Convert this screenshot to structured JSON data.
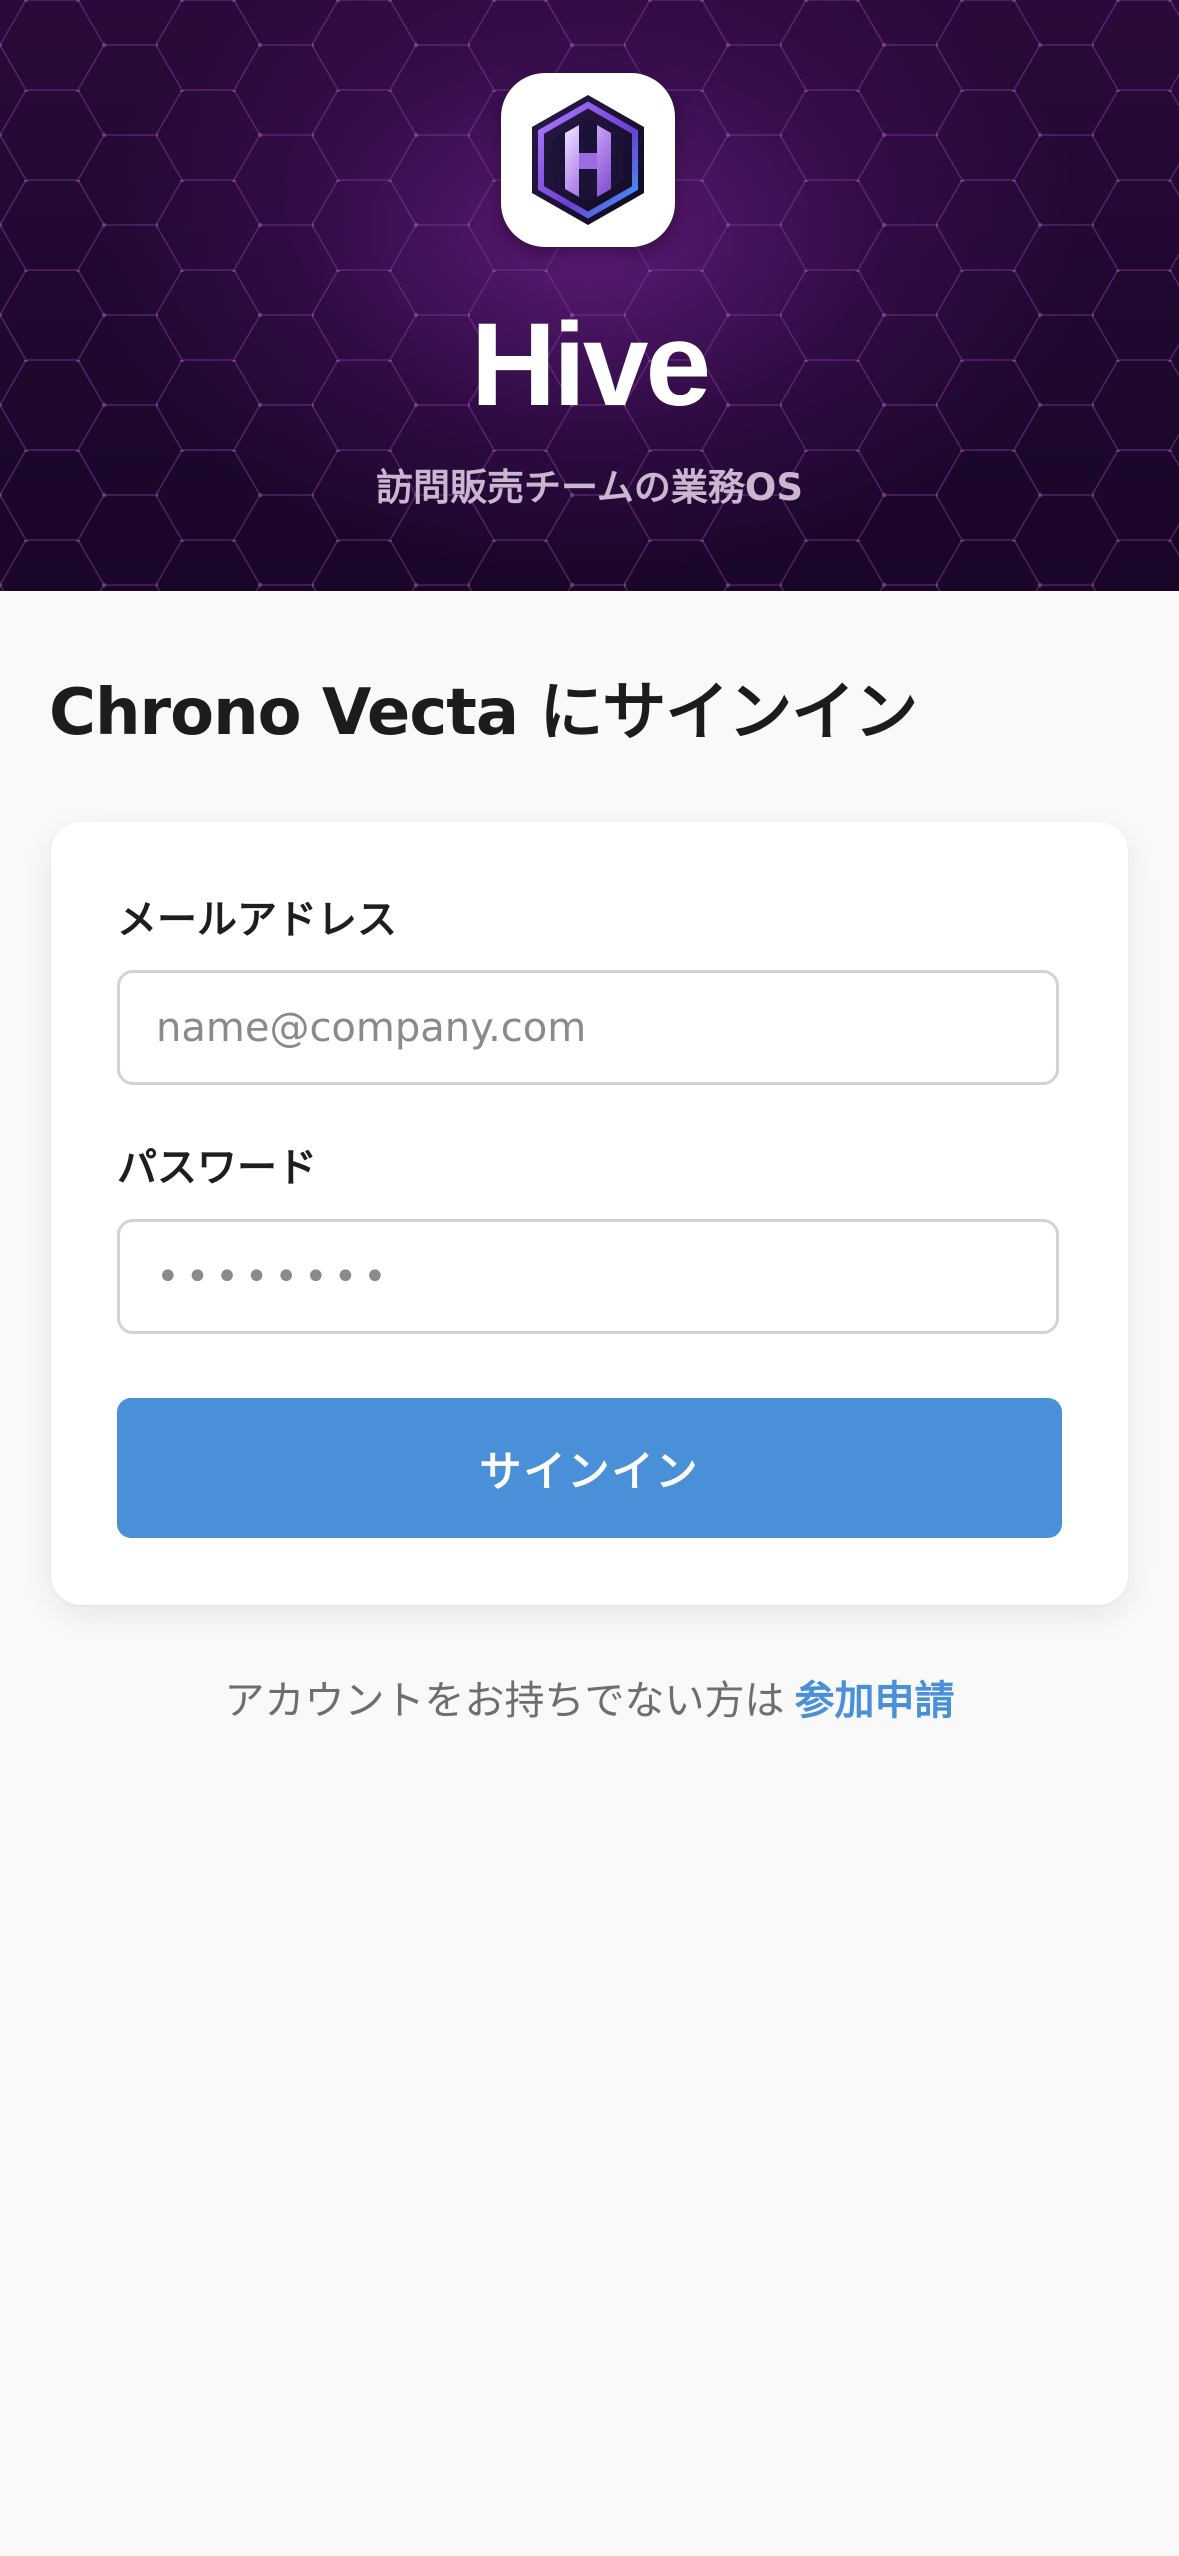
{
  "hero": {
    "app_name": "Hive",
    "tagline": "訪問販売チームの業務OS",
    "logo_icon": "hive-hexagon-logo-icon"
  },
  "signin": {
    "heading": "Chrono Vecta にサインイン",
    "email_label": "メールアドレス",
    "email_placeholder": "name@company.com",
    "password_label": "パスワード",
    "password_placeholder": "••••••••",
    "submit_label": "サインイン"
  },
  "footer": {
    "prompt": "アカウントをお持ちでない方は",
    "link": "参加申請"
  },
  "colors": {
    "accent": "#4a90d9",
    "hero_bg": "#1f0830",
    "page_bg": "#f9f9f9"
  }
}
